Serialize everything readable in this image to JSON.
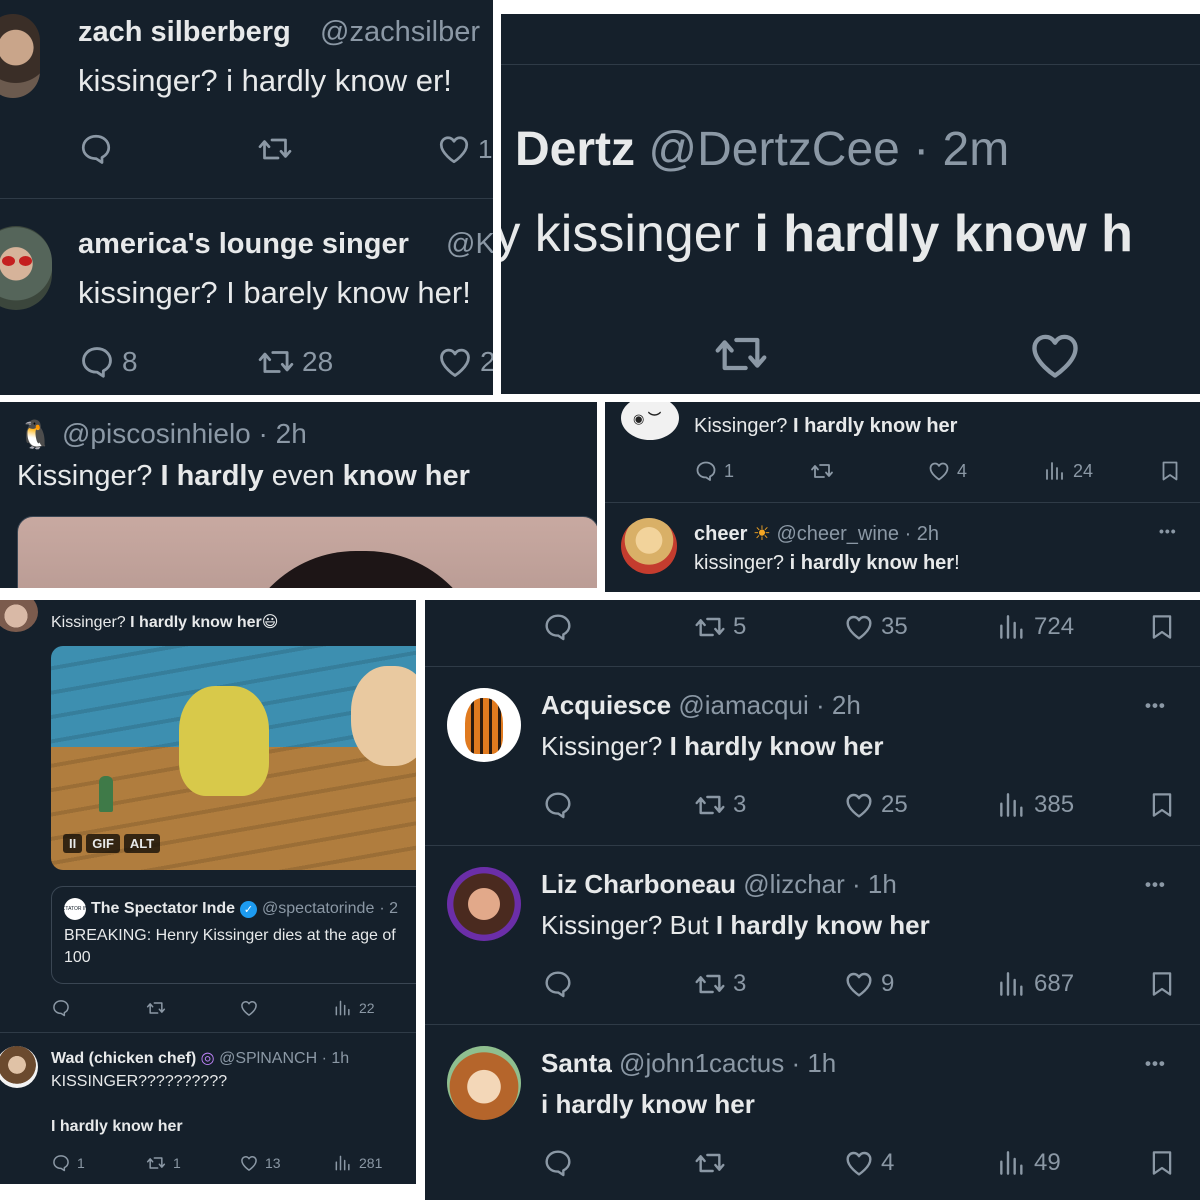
{
  "colors": {
    "background": "#15202b",
    "text": "#e7e9ea",
    "muted": "#8b98a5",
    "verified": "#1d9bf0"
  },
  "p1": {
    "tweet1": {
      "name": "zach silberberg",
      "handle": "@zachsilber",
      "text": "kissinger? i hardly know er!",
      "likes": "1"
    },
    "tweet2": {
      "name": "america's lounge singer",
      "handle": "@K",
      "text": "kissinger? I barely know her!",
      "replies": "8",
      "retweets": "28",
      "likes": "2"
    }
  },
  "p2": {
    "name": "Dertz",
    "handle": "@DertzCee",
    "time": "· 2m",
    "text_normal": "ry kissinger",
    "text_bold": "i hardly know h"
  },
  "p3": {
    "handle": "@piscosinhielo",
    "time": "· 2h",
    "t1": "Kissinger?",
    "t2": "I hardly",
    "t3": "even",
    "t4": "know her"
  },
  "p4": {
    "tweet1": {
      "t1": "Kissinger?",
      "t2": "I hardly know her",
      "replies": "1",
      "likes": "4",
      "views": "24"
    },
    "tweet2": {
      "name": "cheer",
      "handle": "@cheer_wine",
      "time": "· 2h",
      "t1": "kissinger?",
      "t2": "i hardly know her",
      "t3": "!"
    }
  },
  "p5": {
    "tweet1": {
      "t1": "Kissinger?",
      "t2": "I hardly know her",
      "emoji": "😃",
      "gif_badge": "GIF",
      "alt_badge": "ALT",
      "pause_icon": "II"
    },
    "quote": {
      "name": "The Spectator Inde",
      "handle": "@spectatorinde",
      "time": "· 2",
      "text": "BREAKING: Henry Kissinger dies at the age of",
      "text2": "100",
      "views": "22",
      "logo_text": "SPECTATOR INDEX"
    },
    "tweet2": {
      "name": "Wad (chicken chef)",
      "handle": "@SPlNANCH",
      "time": "· 1h",
      "line1": "KISSINGER??????????",
      "line2": "I hardly know her",
      "replies": "1",
      "retweets": "1",
      "likes": "13",
      "views": "281"
    }
  },
  "p6": {
    "top_actions": {
      "retweets": "5",
      "likes": "35",
      "views": "724"
    },
    "tweets": [
      {
        "name": "Acquiesce",
        "handle": "@iamacqui",
        "time": "· 2h",
        "t1": "Kissinger?",
        "t2": "",
        "t3": "I hardly know her",
        "retweets": "3",
        "likes": "25",
        "views": "385"
      },
      {
        "name": "Liz Charboneau",
        "handle": "@lizchar",
        "time": "· 1h",
        "t1": "Kissinger?",
        "t2": "But",
        "t3": "I hardly know her",
        "retweets": "3",
        "likes": "9",
        "views": "687"
      },
      {
        "name": "Santa",
        "handle": "@john1cactus",
        "time": "· 1h",
        "t1": "",
        "t2": "",
        "t3": "i hardly know her",
        "retweets": "",
        "likes": "4",
        "views": "49"
      }
    ],
    "more": "•••"
  }
}
